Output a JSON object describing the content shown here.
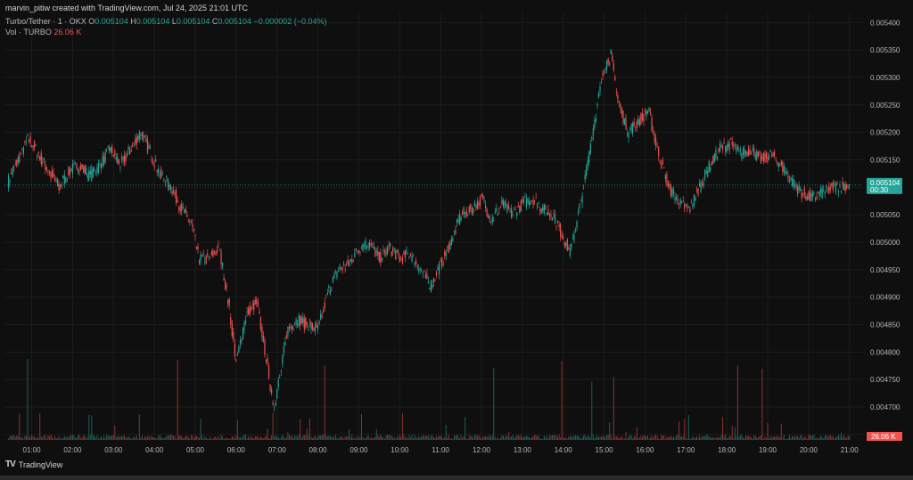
{
  "header": {
    "credit": "marvin_pitiw created with TradingView.com, Jul 24, 2025 21:01 UTC",
    "symbol": "Turbo/Tether · 1 · OKX",
    "ohlc": [
      {
        "k": "O",
        "v": "0.005104"
      },
      {
        "k": "H",
        "v": "0.005104"
      },
      {
        "k": "L",
        "v": "0.005104"
      },
      {
        "k": "C",
        "v": "0.005104"
      }
    ],
    "change": "−0.000002 (−0.04%)",
    "volume_label": "Vol · TURBO",
    "volume_value": "26.06 K"
  },
  "watermark": {
    "logo": "TV",
    "text": "TradingView"
  },
  "colors": {
    "up": "#26a69a",
    "down": "#ef5350",
    "background": "#0f0f0f",
    "grid": "#1c1c1c",
    "axis_text": "#b2b5be"
  },
  "chart_data": {
    "type": "candlestick",
    "symbol": "Turbo/Tether",
    "interval": "1",
    "exchange": "OKX",
    "x_ticks": [
      "01:00",
      "02:00",
      "03:00",
      "04:00",
      "05:00",
      "06:00",
      "07:00",
      "08:00",
      "09:00",
      "10:00",
      "11:00",
      "12:00",
      "13:00",
      "14:00",
      "15:00",
      "16:00",
      "17:00",
      "18:00",
      "19:00",
      "20:00",
      "21:00"
    ],
    "y_ticks": [
      "0.005400",
      "0.005350",
      "0.005300",
      "0.005250",
      "0.005200",
      "0.005150",
      "0.005100",
      "0.005050",
      "0.005000",
      "0.004950",
      "0.004900",
      "0.004850",
      "0.004800",
      "0.004750",
      "0.004700",
      "0.004650"
    ],
    "ylim": [
      0.00464,
      0.00542
    ],
    "xlim": [
      "00:20",
      "21:20"
    ],
    "grid": true,
    "last_price": {
      "value": "0.005104",
      "countdown": "00:30"
    },
    "last_volume": "26.06 K",
    "price_path": [
      [
        "00:25",
        0.00511
      ],
      [
        "00:40",
        0.00515
      ],
      [
        "00:55",
        0.00519
      ],
      [
        "01:10",
        0.00516
      ],
      [
        "01:25",
        0.00513
      ],
      [
        "01:40",
        0.0051
      ],
      [
        "01:55",
        0.00513
      ],
      [
        "02:10",
        0.00514
      ],
      [
        "02:25",
        0.00512
      ],
      [
        "02:40",
        0.00514
      ],
      [
        "02:55",
        0.00517
      ],
      [
        "03:10",
        0.00514
      ],
      [
        "03:25",
        0.00517
      ],
      [
        "03:40",
        0.0052
      ],
      [
        "03:55",
        0.00516
      ],
      [
        "04:10",
        0.00512
      ],
      [
        "04:25",
        0.0051
      ],
      [
        "04:40",
        0.00506
      ],
      [
        "04:55",
        0.00503
      ],
      [
        "05:05",
        0.00497
      ],
      [
        "05:20",
        0.00497
      ],
      [
        "05:35",
        0.00499
      ],
      [
        "05:50",
        0.00488
      ],
      [
        "06:00",
        0.00478
      ],
      [
        "06:15",
        0.00487
      ],
      [
        "06:30",
        0.00489
      ],
      [
        "06:40",
        0.00482
      ],
      [
        "06:55",
        0.0047
      ],
      [
        "07:05",
        0.00476
      ],
      [
        "07:15",
        0.00484
      ],
      [
        "07:30",
        0.00486
      ],
      [
        "07:45",
        0.00485
      ],
      [
        "08:00",
        0.00484
      ],
      [
        "08:15",
        0.00491
      ],
      [
        "08:30",
        0.00495
      ],
      [
        "08:45",
        0.00496
      ],
      [
        "09:00",
        0.00499
      ],
      [
        "09:15",
        0.005
      ],
      [
        "09:30",
        0.00497
      ],
      [
        "09:45",
        0.00499
      ],
      [
        "10:00",
        0.00497
      ],
      [
        "10:15",
        0.00498
      ],
      [
        "10:30",
        0.00495
      ],
      [
        "10:45",
        0.00492
      ],
      [
        "11:00",
        0.00496
      ],
      [
        "11:15",
        0.005
      ],
      [
        "11:30",
        0.00505
      ],
      [
        "11:45",
        0.00506
      ],
      [
        "12:00",
        0.00508
      ],
      [
        "12:15",
        0.00504
      ],
      [
        "12:30",
        0.00507
      ],
      [
        "12:45",
        0.00505
      ],
      [
        "13:00",
        0.00507
      ],
      [
        "13:15",
        0.00508
      ],
      [
        "13:30",
        0.00506
      ],
      [
        "13:45",
        0.00505
      ],
      [
        "14:00",
        0.00501
      ],
      [
        "14:10",
        0.00498
      ],
      [
        "14:20",
        0.00504
      ],
      [
        "14:30",
        0.0051
      ],
      [
        "14:40",
        0.00518
      ],
      [
        "14:50",
        0.00525
      ],
      [
        "15:00",
        0.00532
      ],
      [
        "15:10",
        0.00534
      ],
      [
        "15:20",
        0.00526
      ],
      [
        "15:35",
        0.0052
      ],
      [
        "15:50",
        0.00522
      ],
      [
        "16:05",
        0.00524
      ],
      [
        "16:20",
        0.00516
      ],
      [
        "16:35",
        0.0051
      ],
      [
        "16:50",
        0.00507
      ],
      [
        "17:05",
        0.00506
      ],
      [
        "17:20",
        0.0051
      ],
      [
        "17:35",
        0.00514
      ],
      [
        "17:50",
        0.00517
      ],
      [
        "18:05",
        0.00518
      ],
      [
        "18:20",
        0.00516
      ],
      [
        "18:35",
        0.00517
      ],
      [
        "18:50",
        0.00515
      ],
      [
        "19:05",
        0.00516
      ],
      [
        "19:20",
        0.00514
      ],
      [
        "19:35",
        0.00511
      ],
      [
        "19:50",
        0.00509
      ],
      [
        "20:05",
        0.00508
      ],
      [
        "20:20",
        0.00509
      ],
      [
        "20:35",
        0.0051
      ],
      [
        "21:00",
        0.005104
      ]
    ]
  }
}
